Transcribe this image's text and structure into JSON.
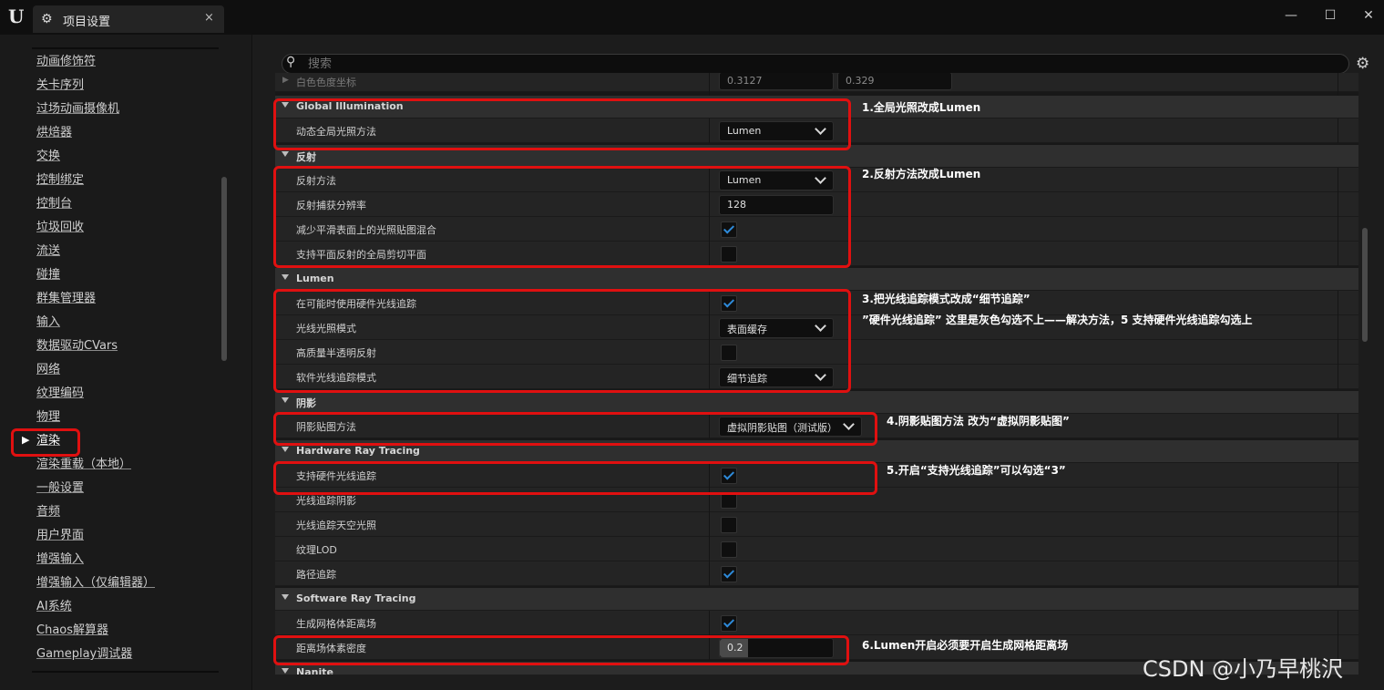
{
  "window": {
    "tab_title": "项目设置",
    "close_glyph": "×",
    "minimize_glyph": "—",
    "maximize_glyph": "☐",
    "close_window_glyph": "✕",
    "logo_text": "U"
  },
  "sidebar": {
    "items": [
      {
        "label": "动画修饰符"
      },
      {
        "label": "关卡序列"
      },
      {
        "label": "过场动画摄像机"
      },
      {
        "label": "烘焙器"
      },
      {
        "label": "交换"
      },
      {
        "label": "控制绑定"
      },
      {
        "label": "控制台"
      },
      {
        "label": "垃圾回收"
      },
      {
        "label": "流送"
      },
      {
        "label": "碰撞"
      },
      {
        "label": "群集管理器"
      },
      {
        "label": "输入"
      },
      {
        "label": "数据驱动CVars"
      },
      {
        "label": "网络"
      },
      {
        "label": "纹理编码"
      },
      {
        "label": "物理"
      },
      {
        "label": "渲染"
      },
      {
        "label": "渲染重载（本地）"
      },
      {
        "label": "一般设置"
      },
      {
        "label": "音频"
      },
      {
        "label": "用户界面"
      },
      {
        "label": "增强输入"
      },
      {
        "label": "增强输入（仅编辑器）"
      },
      {
        "label": "AI系统"
      },
      {
        "label": "Chaos解算器"
      },
      {
        "label": "Gameplay调试器"
      }
    ],
    "active_item": "渲染"
  },
  "search": {
    "placeholder": "搜索"
  },
  "partial_row": {
    "label": "白色色度坐标",
    "value1": "0.3127",
    "value2": "0.329"
  },
  "sections": {
    "gi": {
      "title": "Global Illumination",
      "dgi_label": "动态全局光照方法",
      "dgi_value": "Lumen"
    },
    "reflection": {
      "title": "反射",
      "method_label": "反射方法",
      "method_value": "Lumen",
      "capture_label": "反射捕获分辨率",
      "capture_value": "128",
      "reduce_label": "减少平滑表面上的光照贴图混合",
      "reduce_checked": true,
      "planar_label": "支持平面反射的全局剪切平面",
      "planar_checked": false
    },
    "lumen": {
      "title": "Lumen",
      "hw_label": "在可能时使用硬件光线追踪",
      "hw_checked": true,
      "mode_label": "光线光照模式",
      "mode_value": "表面缓存",
      "hq_label": "高质量半透明反射",
      "hq_checked": false,
      "sw_label": "软件光线追踪模式",
      "sw_value": "细节追踪"
    },
    "shadow": {
      "title": "阴影",
      "method_label": "阴影贴图方法",
      "method_value": "虚拟阴影贴图（测试版）"
    },
    "hwrt": {
      "title": "Hardware Ray Tracing",
      "support_label": "支持硬件光线追踪",
      "support_checked": true,
      "shadow_label": "光线追踪阴影",
      "shadow_checked": false,
      "sky_label": "光线追踪天空光照",
      "sky_checked": false,
      "lod_label": "纹理LOD",
      "lod_checked": false,
      "path_label": "路径追踪",
      "path_checked": true
    },
    "swrt": {
      "title": "Software Ray Tracing",
      "df_label": "生成网格体距离场",
      "df_checked": true,
      "density_label": "距离场体素密度",
      "density_value": "0.2",
      "density_fill": 0.25
    },
    "nanite": {
      "title": "Nanite"
    }
  },
  "annotations": {
    "a1": "1.全局光照改成Lumen",
    "a2": "2.反射方法改成Lumen",
    "a3_line1": "3.把光线追踪模式改成“细节追踪”",
    "a3_line2": "”硬件光线追踪” 这里是灰色勾选不上——解决方法，5 支持硬件光线追踪勾选上",
    "a4": "4.阴影贴图方法 改为“虚拟阴影贴图”",
    "a5": "5.开启“支持光线追踪”可以勾选“3”",
    "a6": "6.Lumen开启必须要开启生成网格距离场"
  },
  "watermark": "CSDN @小乃早桃沢",
  "colors": {
    "annotation_box": "#e01010",
    "checkbox_check": "#2e8bdb",
    "panel_bg": "#242424",
    "category_bg": "#2f2f2f"
  }
}
